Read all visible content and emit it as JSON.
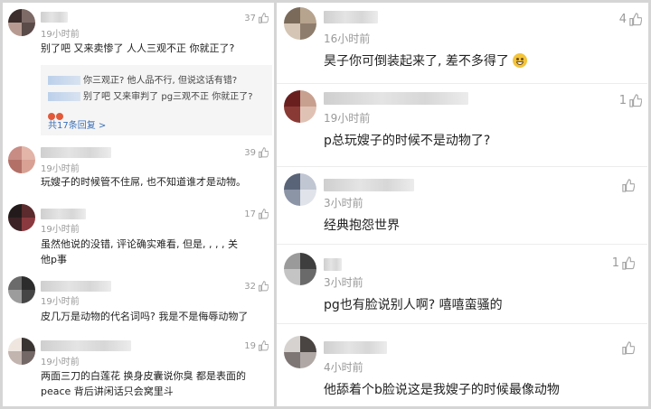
{
  "left_comments": [
    {
      "time": "19小时前",
      "text": "别了吧 又来卖惨了 人人三观不正 你就正了?",
      "likes": "37",
      "replies": [
        {
          "text": "你三观正? 他人品不行, 但说这话有错?"
        },
        {
          "text": "别了吧 又来审判了 pg三观不正 你就正了?"
        }
      ],
      "reply_more": "共17条回复 >"
    },
    {
      "time": "19小时前",
      "text": "玩嫂子的时候管不住屌, 也不知道谁才是动物。",
      "likes": "39"
    },
    {
      "time": "19小时前",
      "text": "虽然他说的没错, 评论确实难看, 但是, , , , 关",
      "text2": "他p事",
      "likes": "17"
    },
    {
      "time": "19小时前",
      "text": "皮几万是动物的代名词吗? 我是不是侮辱动物了",
      "likes": "32"
    },
    {
      "time": "19小时前",
      "text": "两面三刀的白莲花 换身皮囊说你臭 都是表面的",
      "text2": "peace 背后讲闲话只会窝里斗",
      "likes": "19"
    }
  ],
  "right_comments": [
    {
      "time": "16小时前",
      "text": "昊子你可倒装起来了, 差不多得了",
      "likes": "4"
    },
    {
      "time": "19小时前",
      "text": "p总玩嫂子的时候不是动物了?",
      "likes": "1"
    },
    {
      "time": "3小时前",
      "text": "经典抱怨世界",
      "likes": ""
    },
    {
      "time": "3小时前",
      "text": "pg也有脸说别人啊? 嘻嘻蛮骚的",
      "likes": "1"
    },
    {
      "time": "4小时前",
      "text": "他舔着个b脸说这是我嫂子的时候最像动物",
      "likes": ""
    }
  ],
  "icons": {
    "like": "thumbs-up-icon",
    "emoji": "grinning-sweat-emoji"
  },
  "colors": {
    "text": "#222222",
    "meta": "#999999",
    "link": "#3a6fb8",
    "reply_bg": "#f5f5f5",
    "border": "#d5d5d5"
  }
}
